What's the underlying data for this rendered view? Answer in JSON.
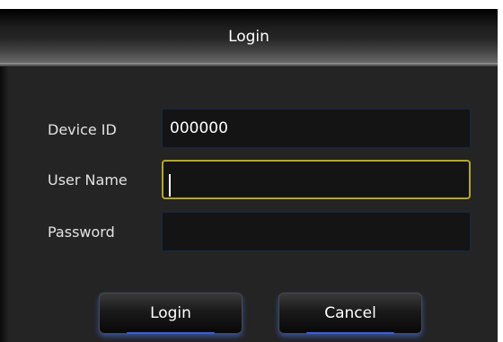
{
  "dialog": {
    "title": "Login",
    "fields": {
      "device_id": {
        "label": "Device ID",
        "value": "000000"
      },
      "user_name": {
        "label": "User Name",
        "value": ""
      },
      "password": {
        "label": "Password",
        "value": ""
      }
    },
    "buttons": {
      "login": "Login",
      "cancel": "Cancel"
    }
  },
  "colors": {
    "background": "#242424",
    "focus_border": "#b7a81a",
    "input_border": "#13294a",
    "button_glow": "#3d5fd0"
  }
}
